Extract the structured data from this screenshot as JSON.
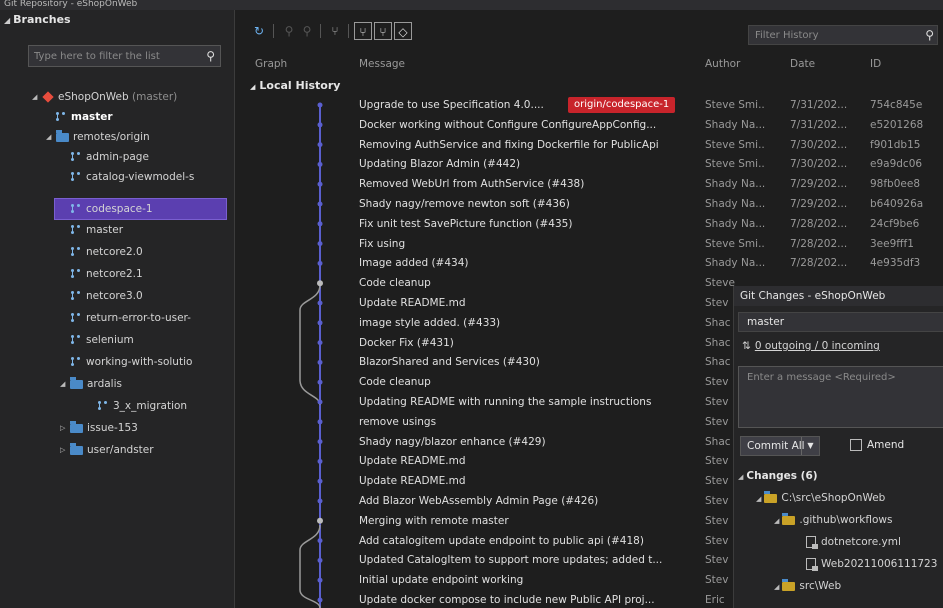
{
  "window": {
    "title": "Git Repository - eShopOnWeb"
  },
  "branches": {
    "header": "Branches",
    "filter_placeholder": "Type here to filter the list",
    "items": [
      {
        "label": "eShopOnWeb",
        "suffix": "(master)",
        "type": "repo"
      },
      {
        "label": "master",
        "type": "branch",
        "bold": true
      },
      {
        "label": "remotes/origin",
        "type": "folder"
      },
      {
        "label": "admin-page",
        "type": "branch"
      },
      {
        "label": "catalog-viewmodel-s",
        "type": "branch"
      },
      {
        "label": "codespace-1",
        "type": "branch",
        "selected": true
      },
      {
        "label": "master",
        "type": "branch"
      },
      {
        "label": "netcore2.0",
        "type": "branch"
      },
      {
        "label": "netcore2.1",
        "type": "branch"
      },
      {
        "label": "netcore3.0",
        "type": "branch"
      },
      {
        "label": "return-error-to-user-",
        "type": "branch"
      },
      {
        "label": "selenium",
        "type": "branch"
      },
      {
        "label": "working-with-solutio",
        "type": "branch"
      },
      {
        "label": "ardalis",
        "type": "folder"
      },
      {
        "label": "3_x_migration",
        "type": "branch"
      },
      {
        "label": "issue-153",
        "type": "folder"
      },
      {
        "label": "user/andster",
        "type": "folder"
      }
    ]
  },
  "history": {
    "filter_placeholder": "Filter History",
    "columns": {
      "graph": "Graph",
      "message": "Message",
      "author": "Author",
      "date": "Date",
      "id": "ID"
    },
    "section": "Local History",
    "rows": [
      {
        "message": "Upgrade to use Specification 4.0....",
        "tag": "origin/codespace-1",
        "author": "Steve Smi...",
        "date": "7/31/202...",
        "id": "754c845e"
      },
      {
        "message": "Docker working without Configure ConfigureAppConfig...",
        "author": "Shady Na...",
        "date": "7/31/202...",
        "id": "e5201268"
      },
      {
        "message": "Removing AuthService and fixing Dockerfile for PublicApi",
        "author": "Steve Smi...",
        "date": "7/30/202...",
        "id": "f901db15"
      },
      {
        "message": "Updating Blazor Admin (#442)",
        "author": "Steve Smi...",
        "date": "7/30/202...",
        "id": "e9a9dc06"
      },
      {
        "message": "Removed WebUrl from AuthService (#438)",
        "author": "Shady Na...",
        "date": "7/29/202...",
        "id": "98fb0ee8"
      },
      {
        "message": "Shady nagy/remove newton soft (#436)",
        "author": "Shady Na...",
        "date": "7/29/202...",
        "id": "b640926a"
      },
      {
        "message": "Fix unit test SavePicture function (#435)",
        "author": "Shady Na...",
        "date": "7/28/202...",
        "id": "24cf9be6"
      },
      {
        "message": "Fix using",
        "author": "Steve Smi...",
        "date": "7/28/202...",
        "id": "3ee9fff1"
      },
      {
        "message": "Image added (#434)",
        "author": "Shady Na...",
        "date": "7/28/202...",
        "id": "4e935df3"
      },
      {
        "message": "Code cleanup",
        "author": "Steve",
        "date": "",
        "id": ""
      },
      {
        "message": "Update README.md",
        "author": "Stev",
        "date": "",
        "id": ""
      },
      {
        "message": "image style added. (#433)",
        "author": "Shac",
        "date": "",
        "id": ""
      },
      {
        "message": "Docker Fix (#431)",
        "author": "Shac",
        "date": "",
        "id": ""
      },
      {
        "message": "BlazorShared and Services (#430)",
        "author": "Shac",
        "date": "",
        "id": ""
      },
      {
        "message": "Code cleanup",
        "author": "Stev",
        "date": "",
        "id": ""
      },
      {
        "message": "Updating README with running the sample instructions",
        "author": "Stev",
        "date": "",
        "id": ""
      },
      {
        "message": "remove usings",
        "author": "Stev",
        "date": "",
        "id": ""
      },
      {
        "message": "Shady nagy/blazor enhance (#429)",
        "author": "Shac",
        "date": "",
        "id": ""
      },
      {
        "message": "Update README.md",
        "author": "Stev",
        "date": "",
        "id": ""
      },
      {
        "message": "Update README.md",
        "author": "Stev",
        "date": "",
        "id": ""
      },
      {
        "message": "Add Blazor WebAssembly Admin Page (#426)",
        "author": "Stev",
        "date": "",
        "id": ""
      },
      {
        "message": "Merging with remote master",
        "author": "Stev",
        "date": "",
        "id": ""
      },
      {
        "message": "Add catalogitem update endpoint to public api (#418)",
        "author": "Stev",
        "date": "",
        "id": ""
      },
      {
        "message": "Updated CatalogItem to support more updates; added t...",
        "author": "Stev",
        "date": "",
        "id": ""
      },
      {
        "message": "Initial update endpoint working",
        "author": "Stev",
        "date": "",
        "id": ""
      },
      {
        "message": "Update docker compose to include new Public API proj...",
        "author": "Eric",
        "date": "",
        "id": ""
      }
    ]
  },
  "git_changes": {
    "title": "Git Changes - eShopOnWeb",
    "branch": "master",
    "sync": "0 outgoing / 0 incoming",
    "message_placeholder": "Enter a message <Required>",
    "commit_label": "Commit All",
    "amend_label": "Amend",
    "changes_label": "Changes (6)",
    "tree": [
      {
        "label": "C:\\src\\eShopOnWeb",
        "type": "folder"
      },
      {
        "label": ".github\\workflows",
        "type": "folder"
      },
      {
        "label": "dotnetcore.yml",
        "type": "file"
      },
      {
        "label": "Web20211006111723",
        "type": "file"
      },
      {
        "label": "src\\Web",
        "type": "folder"
      }
    ]
  },
  "colors": {
    "selected": "#5b3fb0",
    "tag": "#c8242b",
    "graph_line": "#5a5fcf",
    "graph_merge_line": "#9a9a9a"
  }
}
